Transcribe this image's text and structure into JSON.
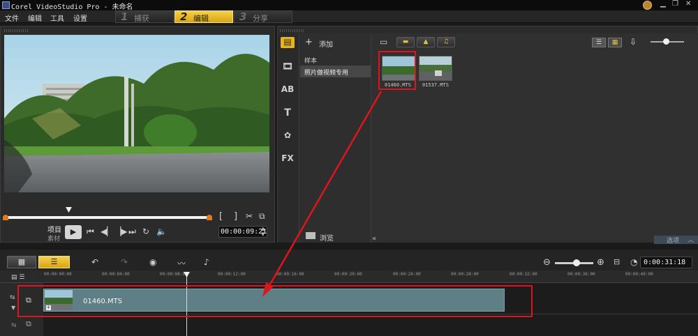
{
  "window": {
    "title": "Corel VideoStudio Pro - 未命名",
    "controls": [
      "minimize-icon",
      "restore-icon",
      "close-icon"
    ]
  },
  "menu": [
    "文件",
    "编辑",
    "工具",
    "设置"
  ],
  "steps": [
    {
      "num": "1",
      "label": "捕获"
    },
    {
      "num": "2",
      "label": "编辑"
    },
    {
      "num": "3",
      "label": "分享"
    }
  ],
  "preview": {
    "mode_project": "项目",
    "mode_clip": "素材",
    "timecode": "00:00:09:21",
    "trim_in": "[",
    "trim_out": "]"
  },
  "library": {
    "add_label": "添加",
    "folders": [
      "样本",
      "照片做视频专用"
    ],
    "browse_label": "浏览",
    "options_label": "选项",
    "media": [
      {
        "file": "01460.MTS"
      },
      {
        "file": "01537.MTS"
      }
    ]
  },
  "timeline": {
    "timecode": "0:00:31:18",
    "ruler": [
      "00:00:00:00",
      "00:00:04:00",
      "00:00:08:00",
      "00:00:12:00",
      "00:00:16:00",
      "00:00:20:00",
      "00:00:24:00",
      "00:00:28:00",
      "00:00:32:00",
      "00:00:36:00",
      "00:00:40:00"
    ],
    "clip_name": "01460.MTS"
  },
  "colors": {
    "accent": "#f1c12c",
    "highlight": "#e0141c",
    "clip": "#5e7f85"
  }
}
